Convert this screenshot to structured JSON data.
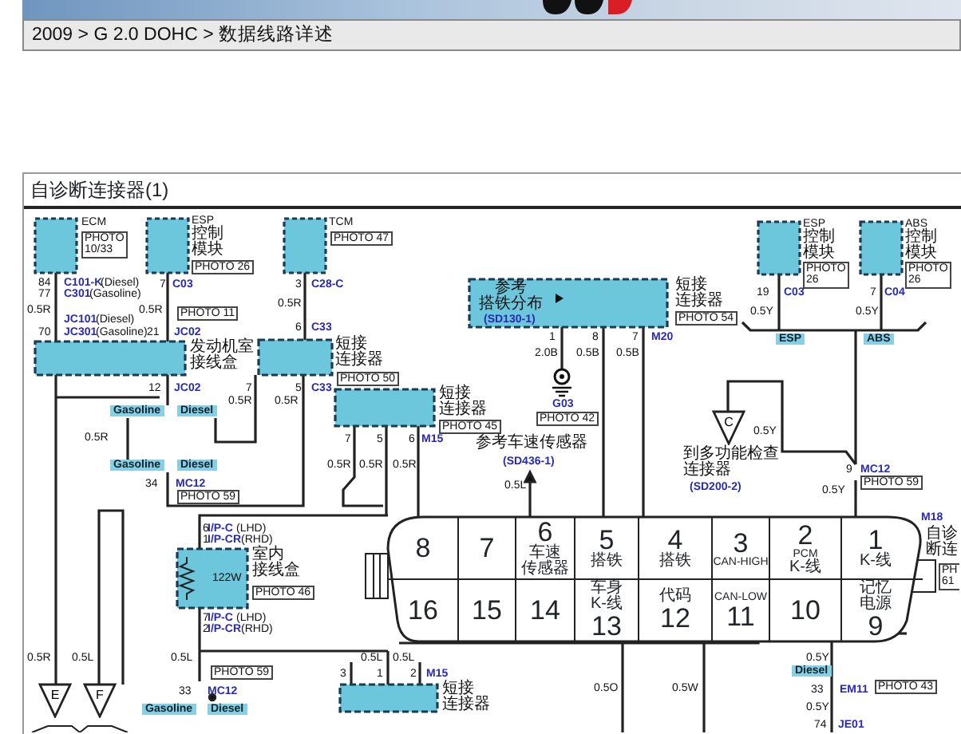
{
  "header": {
    "breadcrumb": "2009 > G 2.0 DOHC > 数据线路详述"
  },
  "panel": {
    "title": "自诊断连接器(1)"
  },
  "modules": [
    {
      "kind": "module",
      "lines": [
        "ECM"
      ],
      "photo": [
        "PHOTO",
        "10/33"
      ]
    },
    {
      "kind": "module",
      "lines": [
        "ESP",
        "控制",
        "模块"
      ],
      "photo": [
        "PHOTO 26"
      ]
    },
    {
      "kind": "module",
      "lines": [
        "TCM"
      ],
      "photo": [
        "PHOTO 47"
      ]
    },
    {
      "kind": "junction",
      "lines": [
        "发动机室",
        "接线盒"
      ]
    },
    {
      "kind": "junction",
      "lines": [
        "短接",
        "连接器"
      ],
      "photo": [
        "PHOTO 50"
      ]
    },
    {
      "kind": "junction",
      "lines": [
        "短接",
        "连接器"
      ],
      "photo": [
        "PHOTO 45"
      ]
    },
    {
      "kind": "junction",
      "lines": [
        "短接",
        "连接器"
      ],
      "photo": [
        "PHOTO 54"
      ],
      "inner": [
        "参考",
        "搭铁分布"
      ],
      "ref": "(SD130-1)"
    },
    {
      "kind": "module",
      "lines": [
        "ESP",
        "控制",
        "模块"
      ],
      "photo": [
        "PHOTO",
        "26"
      ]
    },
    {
      "kind": "module",
      "lines": [
        "ABS",
        "控制",
        "模块"
      ],
      "photo": [
        "PHOTO",
        "26"
      ]
    },
    {
      "kind": "junction",
      "lines": [
        "室内",
        "接线盒"
      ],
      "photo": [
        "PHOTO 46"
      ],
      "inner": [
        "122W"
      ]
    },
    {
      "kind": "junction",
      "lines": [
        "短接",
        "连接器"
      ]
    }
  ],
  "diagnostic_connector": {
    "top_row": [
      {
        "number": "8"
      },
      {
        "number": "7"
      },
      {
        "number": "6",
        "lines": [
          "车速",
          "传感器"
        ]
      },
      {
        "number": "5",
        "lines": [
          "搭铁"
        ]
      },
      {
        "number": "4",
        "lines": [
          "搭铁"
        ]
      },
      {
        "number": "3",
        "lines": [
          "CAN-HIGH"
        ]
      },
      {
        "number": "2",
        "lines": [
          "PCM",
          "K-线"
        ]
      },
      {
        "number": "1",
        "lines": [
          "K-线"
        ]
      }
    ],
    "bottom_row": [
      {
        "number": "16"
      },
      {
        "number": "15"
      },
      {
        "number": "14"
      },
      {
        "number": "13",
        "lines": [
          "车身",
          "K-线"
        ]
      },
      {
        "number": "12",
        "lines": [
          "代码"
        ]
      },
      {
        "number": "11",
        "lines": [
          "CAN-LOW"
        ]
      },
      {
        "number": "10"
      },
      {
        "number": "9",
        "lines": [
          "记忆",
          "电源"
        ]
      }
    ]
  },
  "labels": [
    {
      "kind": "pin",
      "text": "84"
    },
    {
      "kind": "conn",
      "text": "C101-K"
    },
    {
      "kind": "wire",
      "text": "(Diesel)"
    },
    {
      "kind": "pin",
      "text": "77"
    },
    {
      "kind": "conn",
      "text": "C301"
    },
    {
      "kind": "wire",
      "text": "(Gasoline)"
    },
    {
      "kind": "wire",
      "text": "0.5R"
    },
    {
      "kind": "conn",
      "text": "JC101"
    },
    {
      "kind": "wire",
      "text": "(Diesel)"
    },
    {
      "kind": "pin",
      "text": "70"
    },
    {
      "kind": "conn",
      "text": "JC301"
    },
    {
      "kind": "wire",
      "text": "(Gasoline)"
    },
    {
      "kind": "pin",
      "text": "21"
    },
    {
      "kind": "conn",
      "text": "JC02"
    },
    {
      "kind": "pin",
      "text": "7"
    },
    {
      "kind": "conn",
      "text": "C03"
    },
    {
      "kind": "wire",
      "text": "0.5R"
    },
    {
      "kind": "photo",
      "lines": [
        "PHOTO 11"
      ]
    },
    {
      "kind": "pin",
      "text": "12"
    },
    {
      "kind": "conn",
      "text": "JC02"
    },
    {
      "kind": "tag",
      "text": "Gasoline"
    },
    {
      "kind": "tag",
      "text": "Diesel"
    },
    {
      "kind": "wire",
      "text": "0.5R"
    },
    {
      "kind": "pin",
      "text": "3"
    },
    {
      "kind": "conn",
      "text": "C28-C"
    },
    {
      "kind": "wire",
      "text": "0.5R"
    },
    {
      "kind": "pin",
      "text": "6"
    },
    {
      "kind": "conn",
      "text": "C33"
    },
    {
      "kind": "pin",
      "text": "7"
    },
    {
      "kind": "wire",
      "text": "0.5R"
    },
    {
      "kind": "pin",
      "text": "5"
    },
    {
      "kind": "conn",
      "text": "C33"
    },
    {
      "kind": "wire",
      "text": "0.5R"
    },
    {
      "kind": "pin",
      "text": "7"
    },
    {
      "kind": "pin",
      "text": "5"
    },
    {
      "kind": "pin",
      "text": "6"
    },
    {
      "kind": "conn",
      "text": "M15"
    },
    {
      "kind": "pin",
      "text": "1"
    },
    {
      "kind": "pin",
      "text": "8"
    },
    {
      "kind": "pin",
      "text": "7"
    },
    {
      "kind": "conn",
      "text": "M20"
    },
    {
      "kind": "wire",
      "text": "2.0B"
    },
    {
      "kind": "wire",
      "text": "0.5B"
    },
    {
      "kind": "wire",
      "text": "0.5B"
    },
    {
      "kind": "conn",
      "text": "G03"
    },
    {
      "kind": "photo",
      "lines": [
        "PHOTO 42"
      ]
    },
    {
      "kind": "note",
      "lines": [
        "参考车速传感器"
      ]
    },
    {
      "kind": "conn",
      "text": "(SD436-1)"
    },
    {
      "kind": "wire",
      "text": "0.5L"
    },
    {
      "kind": "pin",
      "text": "19"
    },
    {
      "kind": "conn",
      "text": "C03"
    },
    {
      "kind": "wire",
      "text": "0.5Y"
    },
    {
      "kind": "pin",
      "text": "7"
    },
    {
      "kind": "conn",
      "text": "C04"
    },
    {
      "kind": "wire",
      "text": "0.5Y"
    },
    {
      "kind": "tag",
      "text": "ESP"
    },
    {
      "kind": "tag",
      "text": "ABS"
    },
    {
      "kind": "offpage",
      "text": "C"
    },
    {
      "kind": "note",
      "lines": [
        "到多功能检查",
        "连接器"
      ]
    },
    {
      "kind": "conn",
      "text": "(SD200-2)"
    },
    {
      "kind": "wire",
      "text": "0.5Y"
    },
    {
      "kind": "pin",
      "text": "9"
    },
    {
      "kind": "conn",
      "text": "MC12"
    },
    {
      "kind": "photo",
      "lines": [
        "PHOTO 59"
      ]
    },
    {
      "kind": "wire",
      "text": "0.5Y"
    },
    {
      "kind": "conn",
      "text": "M18"
    },
    {
      "kind": "note",
      "lines": [
        "自诊断连"
      ]
    },
    {
      "kind": "photo",
      "lines": [
        "PH",
        "61"
      ]
    },
    {
      "kind": "tag",
      "text": "Gasoline"
    },
    {
      "kind": "tag",
      "text": "Diesel"
    },
    {
      "kind": "pin",
      "text": "34"
    },
    {
      "kind": "conn",
      "text": "MC12"
    },
    {
      "kind": "photo",
      "lines": [
        "PHOTO 59"
      ]
    },
    {
      "kind": "wire",
      "text": "0.5R"
    },
    {
      "kind": "wire",
      "text": "0.5R"
    },
    {
      "kind": "wire",
      "text": "0.5R"
    },
    {
      "kind": "pin",
      "text": "6"
    },
    {
      "kind": "conn",
      "text": "I/P-C"
    },
    {
      "kind": "wire",
      "text": "(LHD)"
    },
    {
      "kind": "pin",
      "text": "1"
    },
    {
      "kind": "conn",
      "text": "I/P-CR"
    },
    {
      "kind": "wire",
      "text": "(RHD)"
    },
    {
      "kind": "pin",
      "text": "7"
    },
    {
      "kind": "conn",
      "text": "I/P-C"
    },
    {
      "kind": "wire",
      "text": "(LHD)"
    },
    {
      "kind": "pin",
      "text": "2"
    },
    {
      "kind": "conn",
      "text": "I/P-CR"
    },
    {
      "kind": "wire",
      "text": "(RHD)"
    },
    {
      "kind": "wire",
      "text": "0.5R"
    },
    {
      "kind": "wire",
      "text": "0.5L"
    },
    {
      "kind": "wire",
      "text": "0.5L"
    },
    {
      "kind": "photo",
      "lines": [
        "PHOTO 59"
      ]
    },
    {
      "kind": "pin",
      "text": "33"
    },
    {
      "kind": "conn",
      "text": "MC12"
    },
    {
      "kind": "tag",
      "text": "Gasoline"
    },
    {
      "kind": "tag",
      "text": "Diesel"
    },
    {
      "kind": "offpage",
      "text": "E"
    },
    {
      "kind": "offpage",
      "text": "F"
    },
    {
      "kind": "wire",
      "text": "0.5L"
    },
    {
      "kind": "wire",
      "text": "0.5L"
    },
    {
      "kind": "pin",
      "text": "3"
    },
    {
      "kind": "pin",
      "text": "1"
    },
    {
      "kind": "pin",
      "text": "2"
    },
    {
      "kind": "conn",
      "text": "M15"
    },
    {
      "kind": "wire",
      "text": "0.5O"
    },
    {
      "kind": "wire",
      "text": "0.5W"
    },
    {
      "kind": "wire",
      "text": "0.5Y"
    },
    {
      "kind": "tag",
      "text": "Diesel"
    },
    {
      "kind": "pin",
      "text": "33"
    },
    {
      "kind": "conn",
      "text": "EM11"
    },
    {
      "kind": "photo",
      "lines": [
        "PHOTO 43"
      ]
    },
    {
      "kind": "wire",
      "text": "0.5Y"
    },
    {
      "kind": "pin",
      "text": "74"
    },
    {
      "kind": "conn",
      "text": "JE01"
    }
  ]
}
